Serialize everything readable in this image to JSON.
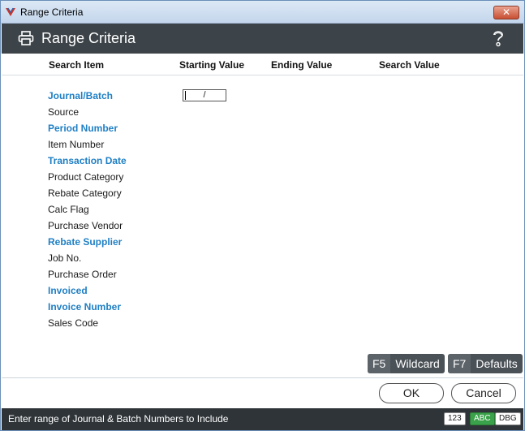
{
  "window": {
    "title": "Range Criteria",
    "close_label": "✕"
  },
  "header": {
    "title": "Range Criteria"
  },
  "columns": {
    "search_item": "Search Item",
    "starting_value": "Starting Value",
    "ending_value": "Ending Value",
    "search_value": "Search Value"
  },
  "rows": [
    {
      "label": "Journal/Batch",
      "required": true
    },
    {
      "label": "Source",
      "required": false
    },
    {
      "label": "Period Number",
      "required": true
    },
    {
      "label": "Item Number",
      "required": false
    },
    {
      "label": "Transaction Date",
      "required": true
    },
    {
      "label": "Product Category",
      "required": false
    },
    {
      "label": "Rebate Category",
      "required": false
    },
    {
      "label": "Calc Flag",
      "required": false
    },
    {
      "label": "Purchase Vendor",
      "required": false
    },
    {
      "label": "Rebate Supplier",
      "required": true
    },
    {
      "label": "Job No.",
      "required": false
    },
    {
      "label": "Purchase Order",
      "required": false
    },
    {
      "label": "Invoiced",
      "required": true
    },
    {
      "label": "Invoice Number",
      "required": true
    },
    {
      "label": "Sales Code",
      "required": false
    }
  ],
  "first_row_input": {
    "value": "/"
  },
  "function_keys": [
    {
      "key": "F5",
      "label": "Wildcard"
    },
    {
      "key": "F7",
      "label": "Defaults"
    }
  ],
  "buttons": {
    "ok": "OK",
    "cancel": "Cancel"
  },
  "status": {
    "message": "Enter range of Journal & Batch Numbers to Include",
    "badges": [
      "123",
      "ABC",
      "DBG"
    ]
  },
  "colors": {
    "header_bg": "#3d4449",
    "required_label": "#1f7fc4",
    "status_bg": "#2f3438",
    "abc_badge": "#3aa24a"
  },
  "icons": [
    "app-logo-icon",
    "printer-icon",
    "help-icon",
    "close-icon"
  ]
}
